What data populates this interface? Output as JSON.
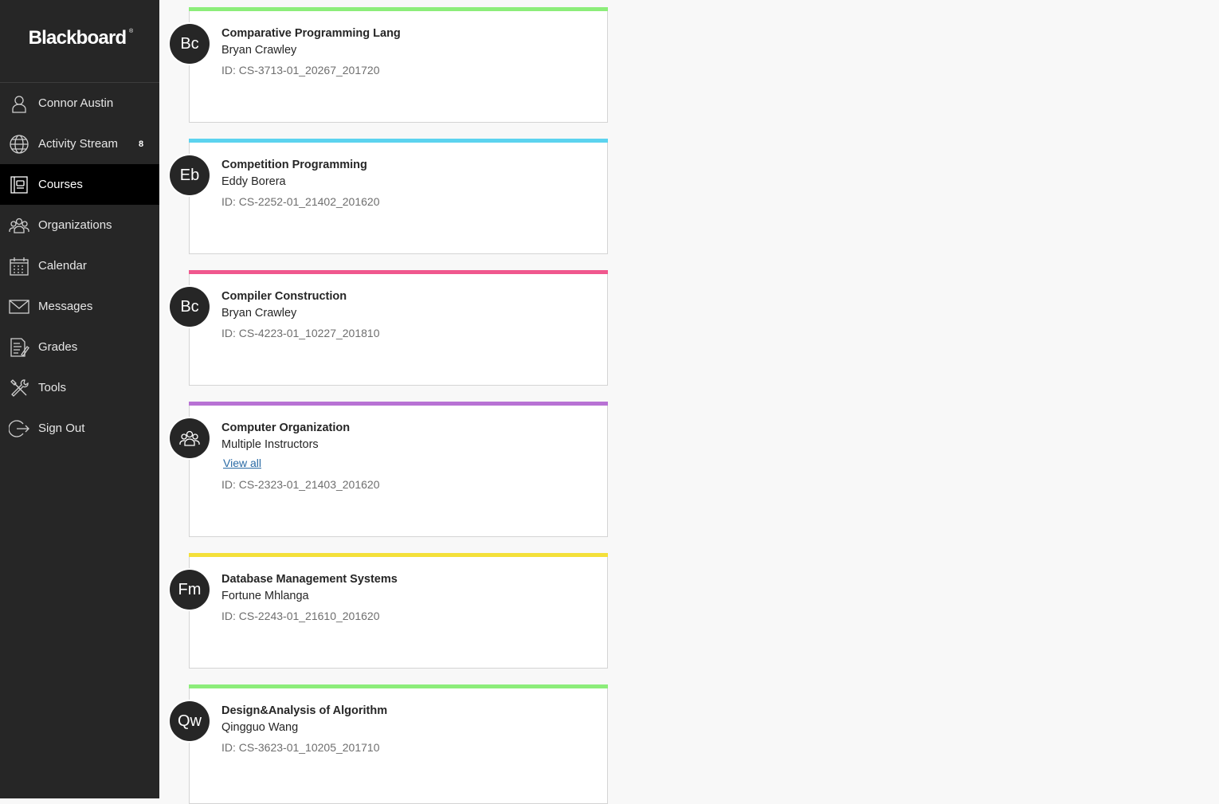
{
  "brand": {
    "logo_text": "Blackboard",
    "registered_mark": "®"
  },
  "sidebar": {
    "items": [
      {
        "label": "Connor Austin",
        "icon": "user-icon"
      },
      {
        "label": "Activity Stream",
        "icon": "globe-icon",
        "badge": "8"
      },
      {
        "label": "Courses",
        "icon": "courses-icon",
        "active": true
      },
      {
        "label": "Organizations",
        "icon": "organizations-icon"
      },
      {
        "label": "Calendar",
        "icon": "calendar-icon"
      },
      {
        "label": "Messages",
        "icon": "envelope-icon"
      },
      {
        "label": "Grades",
        "icon": "grades-icon"
      },
      {
        "label": "Tools",
        "icon": "tools-icon"
      },
      {
        "label": "Sign Out",
        "icon": "sign-out-icon"
      }
    ]
  },
  "courses": [
    {
      "initials": "Bc",
      "title": "Comparative Programming Lang",
      "instructor": "Bryan Crawley",
      "id": "ID: CS-3713-01_20267_201720",
      "color": "#8ced7a"
    },
    {
      "initials": "Eb",
      "title": "Competition Programming",
      "instructor": "Eddy Borera",
      "id": "ID: CS-2252-01_21402_201620",
      "color": "#5cd3ef"
    },
    {
      "initials": "Bc",
      "title": "Compiler Construction",
      "instructor": "Bryan Crawley",
      "id": "ID: CS-4223-01_10227_201810",
      "color": "#f0588e"
    },
    {
      "initials": "",
      "avatar_icon": "group-icon",
      "title": "Computer Organization",
      "instructor": "Multiple Instructors",
      "view_all": "View all",
      "id": "ID: CS-2323-01_21403_201620",
      "color": "#b872d4"
    },
    {
      "initials": "Fm",
      "title": "Database Management Systems",
      "instructor": "Fortune Mhlanga",
      "id": "ID: CS-2243-01_21610_201620",
      "color": "#f4e03a"
    },
    {
      "initials": "Qw",
      "title": "Design&Analysis of Algorithm",
      "instructor": "Qingguo Wang",
      "id": "ID: CS-3623-01_10205_201710",
      "color": "#8ced7a"
    }
  ]
}
